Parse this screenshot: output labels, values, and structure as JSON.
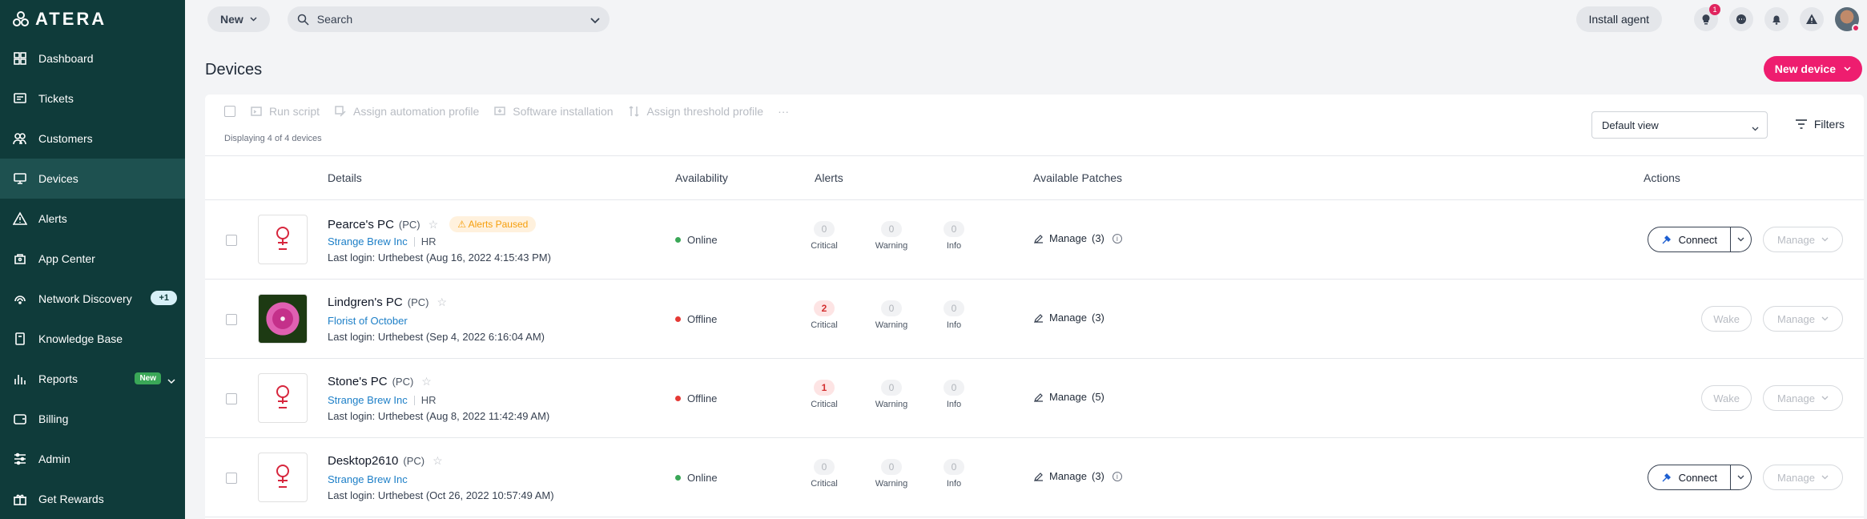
{
  "brand": {
    "name": "ATERA"
  },
  "sidebar": {
    "items": [
      {
        "label": "Dashboard",
        "icon": "dashboard-icon"
      },
      {
        "label": "Tickets",
        "icon": "tickets-icon"
      },
      {
        "label": "Customers",
        "icon": "customers-icon"
      },
      {
        "label": "Devices",
        "icon": "devices-icon",
        "active": true
      },
      {
        "label": "Alerts",
        "icon": "alerts-icon"
      },
      {
        "label": "App Center",
        "icon": "app-center-icon"
      },
      {
        "label": "Network Discovery",
        "icon": "network-icon",
        "count": "+1"
      },
      {
        "label": "Knowledge Base",
        "icon": "book-icon"
      },
      {
        "label": "Reports",
        "icon": "reports-icon",
        "badge": "New"
      },
      {
        "label": "Billing",
        "icon": "billing-icon"
      },
      {
        "label": "Admin",
        "icon": "admin-icon"
      },
      {
        "label": "Get Rewards",
        "icon": "gift-icon"
      }
    ]
  },
  "topbar": {
    "new_label": "New",
    "search_placeholder": "Search",
    "install_label": "Install agent",
    "tips_count": "1"
  },
  "page": {
    "title": "Devices",
    "new_device_label": "New device"
  },
  "toolbar": {
    "run_script": "Run script",
    "assign_automation": "Assign automation profile",
    "software_install": "Software installation",
    "assign_threshold": "Assign threshold profile",
    "more": "···",
    "displaying": "Displaying 4 of 4 devices",
    "view_value": "Default view",
    "filters_label": "Filters"
  },
  "table": {
    "headers": {
      "details": "Details",
      "availability": "Availability",
      "alerts": "Alerts",
      "patches": "Available Patches",
      "actions": "Actions"
    },
    "alert_labels": {
      "critical": "Critical",
      "warning": "Warning",
      "info": "Info"
    },
    "manage_label": "Manage",
    "connect_label": "Connect",
    "wake_label": "Wake",
    "rows": [
      {
        "name": "Pearce's PC",
        "type": "(PC)",
        "paused": "Alerts Paused",
        "customer": "Strange Brew Inc",
        "folder": "HR",
        "login": "Last login: Urthebest (Aug 16, 2022 4:15:43 PM)",
        "status": "Online",
        "status_color": "#3aa757",
        "critical": "0",
        "warning": "0",
        "info": "0",
        "patches": "(3)",
        "action": "connect"
      },
      {
        "name": "Lindgren's PC",
        "type": "(PC)",
        "paused": "",
        "customer": "Florist of October",
        "folder": "",
        "login": "Last login: Urthebest (Sep 4, 2022 6:16:04 AM)",
        "status": "Offline",
        "status_color": "#e53935",
        "critical": "2",
        "warning": "0",
        "info": "0",
        "patches": "(3)",
        "action": "wake"
      },
      {
        "name": "Stone's PC",
        "type": "(PC)",
        "paused": "",
        "customer": "Strange Brew Inc",
        "folder": "HR",
        "login": "Last login: Urthebest (Aug 8, 2022 11:42:49 AM)",
        "status": "Offline",
        "status_color": "#e53935",
        "critical": "1",
        "warning": "0",
        "info": "0",
        "patches": "(5)",
        "action": "wake"
      },
      {
        "name": "Desktop2610",
        "type": "(PC)",
        "paused": "",
        "customer": "Strange Brew Inc",
        "folder": "",
        "login": "Last login: Urthebest (Oct 26, 2022 10:57:49 AM)",
        "status": "Online",
        "status_color": "#3aa757",
        "critical": "0",
        "warning": "0",
        "info": "0",
        "patches": "(3)",
        "action": "connect"
      }
    ]
  }
}
